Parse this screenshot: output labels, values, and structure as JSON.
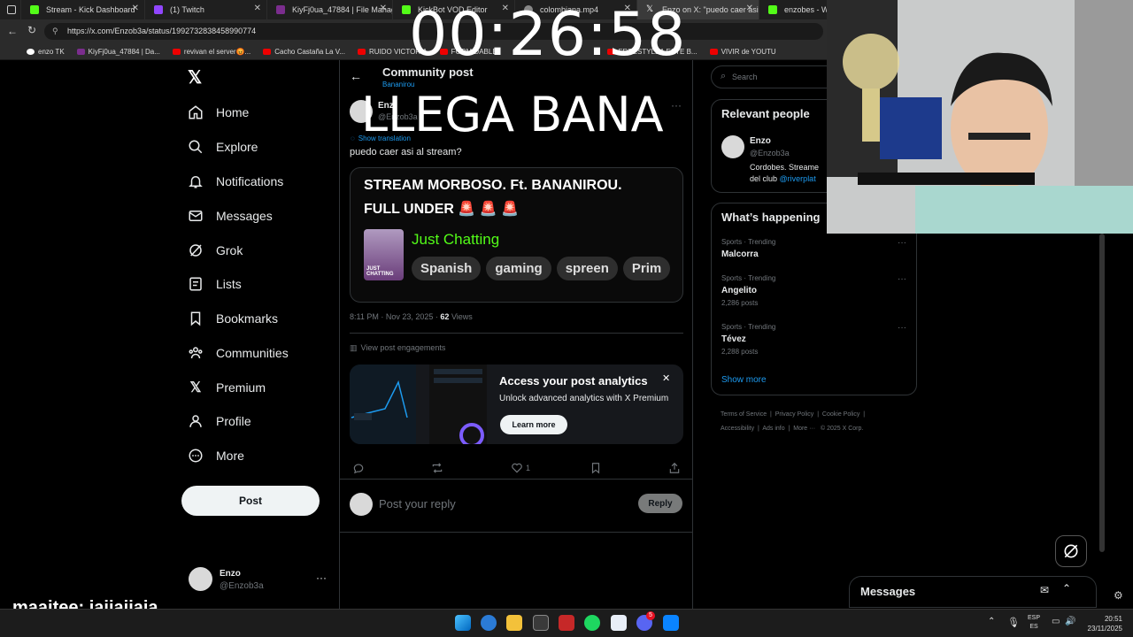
{
  "browser": {
    "tabs": [
      {
        "title": "Stream - Kick Dashboard",
        "color": "#53fc18"
      },
      {
        "title": "(1) Twitch",
        "color": "#9146ff"
      },
      {
        "title": "KiyFj0ua_47884 | File Manag",
        "color": "#7b2d8e"
      },
      {
        "title": "KickBot VOD Editor",
        "color": "#53fc18"
      },
      {
        "title": "colombiana.mp4",
        "color": "#888888"
      },
      {
        "title": "Enzo on X: \"puedo caer asi",
        "color": "#ffffff"
      },
      {
        "title": "enzobes - Wat",
        "color": "#53fc18"
      }
    ],
    "url": "https://x.com/Enzob3a/status/1992732838458990774",
    "bookmarks": [
      "enzo TK",
      "KiyFj0ua_47884 | Da...",
      "revivan el server😡...",
      "Cacho Castaña La V...",
      "RUIDO VICTORIA",
      "FORMIDABLE",
      "FREESTYLEA ESTE B...",
      "VIVIR de YOUTU"
    ]
  },
  "overlay": {
    "timer": "00:26:58",
    "headline": "LLEGA BANA",
    "chat_user": "maaitee:",
    "chat_message": "jajjajjaja"
  },
  "sidebar": {
    "items": [
      {
        "label": "Home",
        "icon": "home-icon"
      },
      {
        "label": "Explore",
        "icon": "search-icon"
      },
      {
        "label": "Notifications",
        "icon": "bell-icon"
      },
      {
        "label": "Messages",
        "icon": "mail-icon"
      },
      {
        "label": "Grok",
        "icon": "grok-icon"
      },
      {
        "label": "Lists",
        "icon": "list-icon"
      },
      {
        "label": "Bookmarks",
        "icon": "bookmark-icon"
      },
      {
        "label": "Communities",
        "icon": "people-icon"
      },
      {
        "label": "Premium",
        "icon": "x-icon"
      },
      {
        "label": "Profile",
        "icon": "person-icon"
      },
      {
        "label": "More",
        "icon": "more-circle-icon"
      }
    ],
    "post_label": "Post",
    "account_name": "Enzo",
    "account_handle": "@Enzob3a"
  },
  "main": {
    "header_title": "Community post",
    "header_sub": "Bananirou",
    "author_name": "Enz",
    "author_handle": "@Enzob3a",
    "show_translation": "Show translation",
    "post_text": "puedo caer asi al stream?",
    "card": {
      "title_line1": "STREAM MORBOSO. Ft. BANANIROU.",
      "title_line2": "FULL UNDER 🚨 🚨 🚨",
      "category": "Just Chatting",
      "thumb_label": "JUST CHATTING",
      "tags": [
        "Spanish",
        "gaming",
        "spreen",
        "Prim"
      ]
    },
    "meta_time": "8:11 PM · Nov 23, 2025 ·",
    "meta_views_count": "62",
    "meta_views_label": "Views",
    "view_engagements": "View post engagements",
    "analytics_title": "Access your post analytics",
    "analytics_sub": "Unlock advanced analytics with X Premium",
    "learn_more": "Learn more",
    "like_count": "1",
    "reply_placeholder": "Post your reply",
    "reply_button": "Reply"
  },
  "right": {
    "search_placeholder": "Search",
    "relevant_title": "Relevant people",
    "person_name": "Enzo",
    "person_handle": "@Enzob3a",
    "person_bio1": "Cordobes. Streame",
    "person_bio2_prefix": "del club",
    "person_bio2_link": "@riverplat",
    "happening_title": "What’s happening",
    "trends": [
      {
        "meta": "Sports · Trending",
        "name": "Malcorra",
        "posts": ""
      },
      {
        "meta": "Sports · Trending",
        "name": "Angelito",
        "posts": "2,286 posts"
      },
      {
        "meta": "Sports · Trending",
        "name": "Tévez",
        "posts": "2,288 posts"
      }
    ],
    "show_more": "Show more",
    "footer_links": [
      "Terms of Service",
      "Privacy Policy",
      "Cookie Policy",
      "Accessibility",
      "Ads info",
      "More ···",
      "© 2025 X Corp."
    ],
    "messages_label": "Messages"
  },
  "taskbar": {
    "lang1": "ESP",
    "lang2": "ES",
    "time": "20:51",
    "date": "23/11/2025",
    "discord_badge": "5"
  }
}
